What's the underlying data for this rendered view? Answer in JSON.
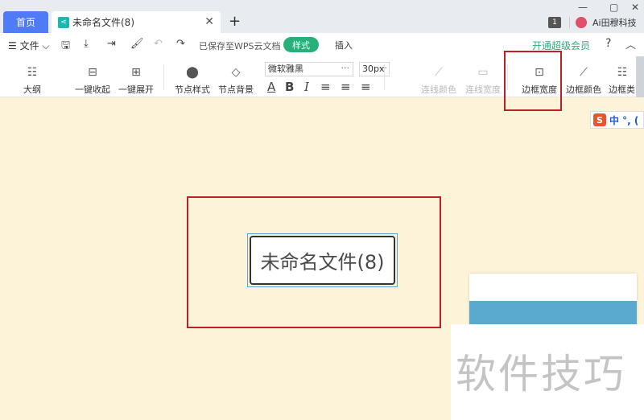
{
  "titlebar": {
    "home_tab": "首页",
    "doc_tab": "未命名文件(8)",
    "close": "✕",
    "add": "+",
    "badge": "1",
    "user": "Ai田穆科技"
  },
  "menubar": {
    "file": "☰ 文件 ⌵",
    "saved": "已保存至WPS云文档",
    "style_tab": "样式",
    "insert_tab": "插入",
    "vip": "开通超级会员",
    "help": "?",
    "collapse": "︿"
  },
  "toolbar": {
    "outline": "大纲",
    "collapse_all": "一键收起",
    "expand_all": "一键展开",
    "node_style": "节点样式",
    "node_bg": "节点背景",
    "font_name": "微软雅黑",
    "font_size": "30px",
    "dots": "···",
    "fmt_color": "A",
    "fmt_bold": "B",
    "fmt_italic": "I",
    "line_color": "连线颜色",
    "line_width": "连线宽度",
    "border_width": "边框宽度",
    "border_color": "边框颜色",
    "border_type": "边框类"
  },
  "canvas": {
    "node_text": "未命名文件(8)",
    "ime_s": "S",
    "ime_text": "中 °, ("
  },
  "watermark": "软件技巧",
  "colors": {
    "accent_blue": "#4f7cf5",
    "accent_green": "#27b07a",
    "highlight_red": "#c01f26",
    "canvas_bg": "#fdf3d8"
  }
}
